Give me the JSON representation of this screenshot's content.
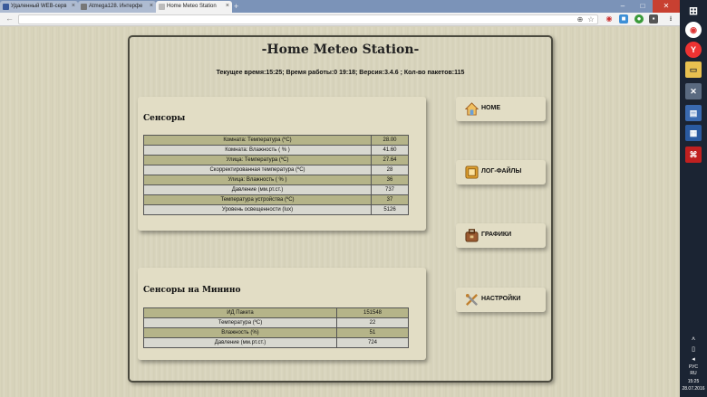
{
  "browser": {
    "tabs": [
      {
        "label": "Удаленный WEB-серв"
      },
      {
        "label": "Atmega128. Интерфе"
      },
      {
        "label": "Home Meteo Station"
      }
    ],
    "new_tab": "+",
    "controls": {
      "minimize": "–",
      "maximize": "□",
      "close": "✕"
    }
  },
  "page": {
    "title": "-Home Meteo Station-",
    "status": "Текущее время:15:25; Время работы:0 19:18; Версия:3.4.6 ; Кол-во пакетов:115"
  },
  "sensors": {
    "title": "Сенсоры",
    "rows": [
      {
        "label": "Комната: Температура (ºC)",
        "value": "28.00"
      },
      {
        "label": "Комната: Влажность ( % )",
        "value": "41.60"
      },
      {
        "label": "Улица: Температура (ºC)",
        "value": "27.64"
      },
      {
        "label": "Скорректированная температура (ºC)",
        "value": "28"
      },
      {
        "label": "Улица: Влажность ( % )",
        "value": "36"
      },
      {
        "label": "Давление (мм.рт.ст.)",
        "value": "737"
      },
      {
        "label": "Температура устройства (ºC)",
        "value": "37"
      },
      {
        "label": "Уровень освещенности (lux)",
        "value": "5126"
      }
    ]
  },
  "minino": {
    "title": "Сенсоры на Минино",
    "rows": [
      {
        "label": "ИД Пакета",
        "value": "151548"
      },
      {
        "label": "Температура (ºC)",
        "value": "22"
      },
      {
        "label": "Влажность (%)",
        "value": "51"
      },
      {
        "label": "Давление (мм.рт.ст.)",
        "value": "724"
      }
    ]
  },
  "nav": {
    "home": "HOME",
    "logs": "ЛОГ-ФАЙЛЫ",
    "charts": "ГРАФИКИ",
    "settings": "НАСТРОЙКИ"
  },
  "tray": {
    "lang": "РУС",
    "region": "RU",
    "time": "15:25",
    "date": "28.07.2016"
  }
}
